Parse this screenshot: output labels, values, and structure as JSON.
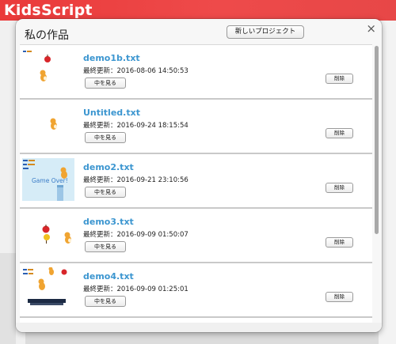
{
  "app": {
    "brand": "KidsScript"
  },
  "dialog": {
    "title": "私の作品",
    "new_project_label": "新しいプロジェクト",
    "close_glyph": "×"
  },
  "projects": [
    {
      "name": "demo1b.txt",
      "updated": "最終更新：2016-08-06 14:50:53",
      "view_label": "中を見る",
      "delete_label": "削除"
    },
    {
      "name": "Untitled.txt",
      "updated": "最終更新：2016-09-24 18:15:54",
      "view_label": "中を見る",
      "delete_label": "削除"
    },
    {
      "name": "demo2.txt",
      "updated": "最終更新：2016-09-21 23:10:56",
      "view_label": "中を見る",
      "delete_label": "削除",
      "thumb_text": "Game Over!"
    },
    {
      "name": "demo3.txt",
      "updated": "最終更新：2016-09-09 01:50:07",
      "view_label": "中を見る",
      "delete_label": "削除"
    },
    {
      "name": "demo4.txt",
      "updated": "最終更新：2016-09-09 01:25:01",
      "view_label": "中を見る",
      "delete_label": "削除"
    }
  ],
  "colors": {
    "header_red": "#ea3a3a",
    "link_blue": "#3c96d0"
  },
  "scroll": {
    "position_fraction": 0.0
  }
}
